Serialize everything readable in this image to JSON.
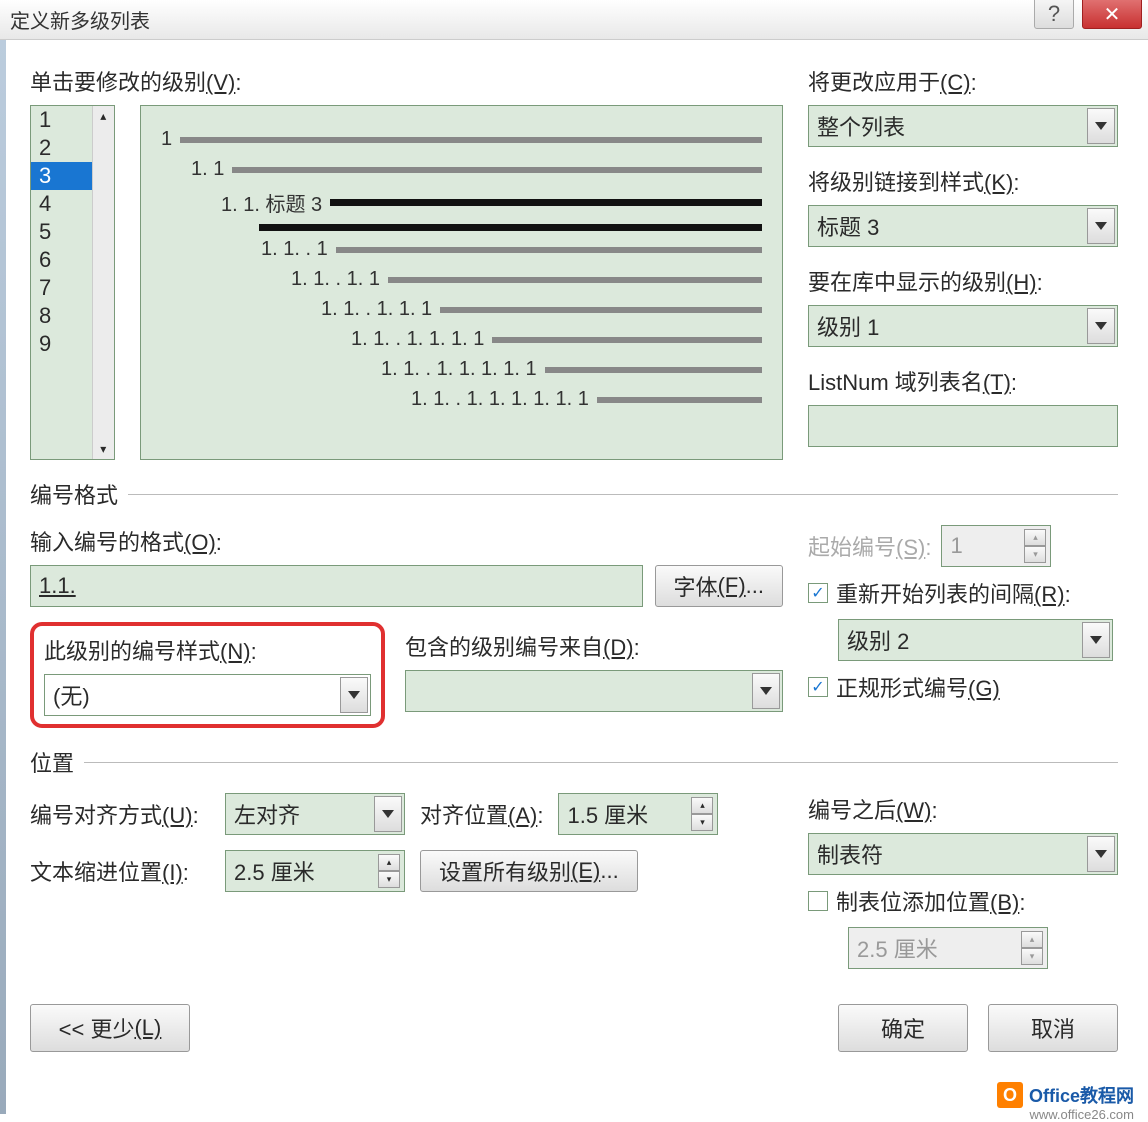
{
  "titlebar": {
    "title": "定义新多级列表"
  },
  "labels": {
    "click_level": "单击要修改的级别",
    "click_level_key": "(V)",
    "apply_to": "将更改应用于",
    "apply_to_key": "(C)",
    "link_style": "将级别链接到样式",
    "link_style_key": "(K)",
    "show_in_gallery": "要在库中显示的级别",
    "show_in_gallery_key": "(H)",
    "listnum": "ListNum 域列表名",
    "listnum_key": "(T)",
    "number_format_group": "编号格式",
    "enter_format": "输入编号的格式",
    "enter_format_key": "(O)",
    "font_btn": "字体",
    "font_btn_key": "(F)",
    "number_style": "此级别的编号样式",
    "number_style_key": "(N)",
    "include_from": "包含的级别编号来自",
    "include_from_key": "(D)",
    "start_at": "起始编号",
    "start_at_key": "(S)",
    "restart_after": "重新开始列表的间隔",
    "restart_after_key": "(R)",
    "legal_format": "正规形式编号",
    "legal_format_key": "(G)",
    "position_group": "位置",
    "align": "编号对齐方式",
    "align_key": "(U)",
    "aligned_at": "对齐位置",
    "aligned_at_key": "(A)",
    "text_indent": "文本缩进位置",
    "text_indent_key": "(I)",
    "set_all": "设置所有级别",
    "set_all_key": "(E)",
    "follow_number": "编号之后",
    "follow_number_key": "(W)",
    "tab_stop": "制表位添加位置",
    "tab_stop_key": "(B)",
    "less_btn": "<< 更少",
    "less_btn_key": "(L)",
    "ok": "确定",
    "cancel": "取消"
  },
  "values": {
    "apply_to": "整个列表",
    "link_style": "标题 3",
    "show_in_gallery": "级别 1",
    "listnum": "",
    "format_text": "1.1.",
    "number_style": "(无)",
    "include_from": "",
    "start_at": "1",
    "restart_level": "级别 2",
    "align": "左对齐",
    "aligned_at": "1.5 厘米",
    "text_indent": "2.5 厘米",
    "follow_number": "制表符",
    "tab_stop": "2.5 厘米",
    "restart_checked": true,
    "legal_checked": true,
    "tab_stop_checked": false
  },
  "levels": [
    "1",
    "2",
    "3",
    "4",
    "5",
    "6",
    "7",
    "8",
    "9"
  ],
  "selected_level": "3",
  "preview": {
    "l1": "1",
    "l2": "1. 1",
    "l3": "1. 1. 标题 3",
    "l4": "1. 1. . 1",
    "l5": "1. 1. . 1. 1",
    "l6": "1. 1. . 1. 1. 1",
    "l7": "1. 1. . 1. 1. 1. 1",
    "l8": "1. 1. . 1. 1. 1. 1. 1",
    "l9": "1. 1. . 1. 1. 1. 1. 1. 1"
  },
  "watermark": {
    "brand": "Office教程网",
    "url": "www.office26.com"
  }
}
